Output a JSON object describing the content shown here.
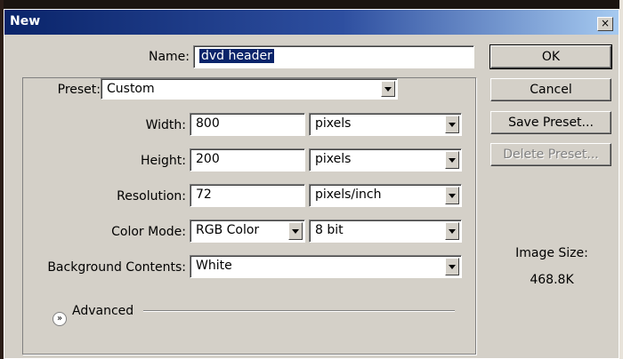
{
  "window": {
    "title": "New",
    "close": "×"
  },
  "name": {
    "label": "Name:",
    "value": "dvd header"
  },
  "preset": {
    "label": "Preset:",
    "value": "Custom"
  },
  "width": {
    "label": "Width:",
    "value": "800",
    "unit": "pixels"
  },
  "height": {
    "label": "Height:",
    "value": "200",
    "unit": "pixels"
  },
  "resolution": {
    "label": "Resolution:",
    "value": "72",
    "unit": "pixels/inch"
  },
  "color_mode": {
    "label": "Color Mode:",
    "value": "RGB Color",
    "depth": "8 bit"
  },
  "background": {
    "label": "Background Contents:",
    "value": "White"
  },
  "advanced": {
    "label": "Advanced",
    "icon": "chevron-double-down-icon"
  },
  "buttons": {
    "ok": "OK",
    "cancel": "Cancel",
    "save_preset": "Save Preset...",
    "delete_preset": "Delete Preset..."
  },
  "image_size": {
    "label": "Image Size:",
    "value": "468.8K"
  }
}
